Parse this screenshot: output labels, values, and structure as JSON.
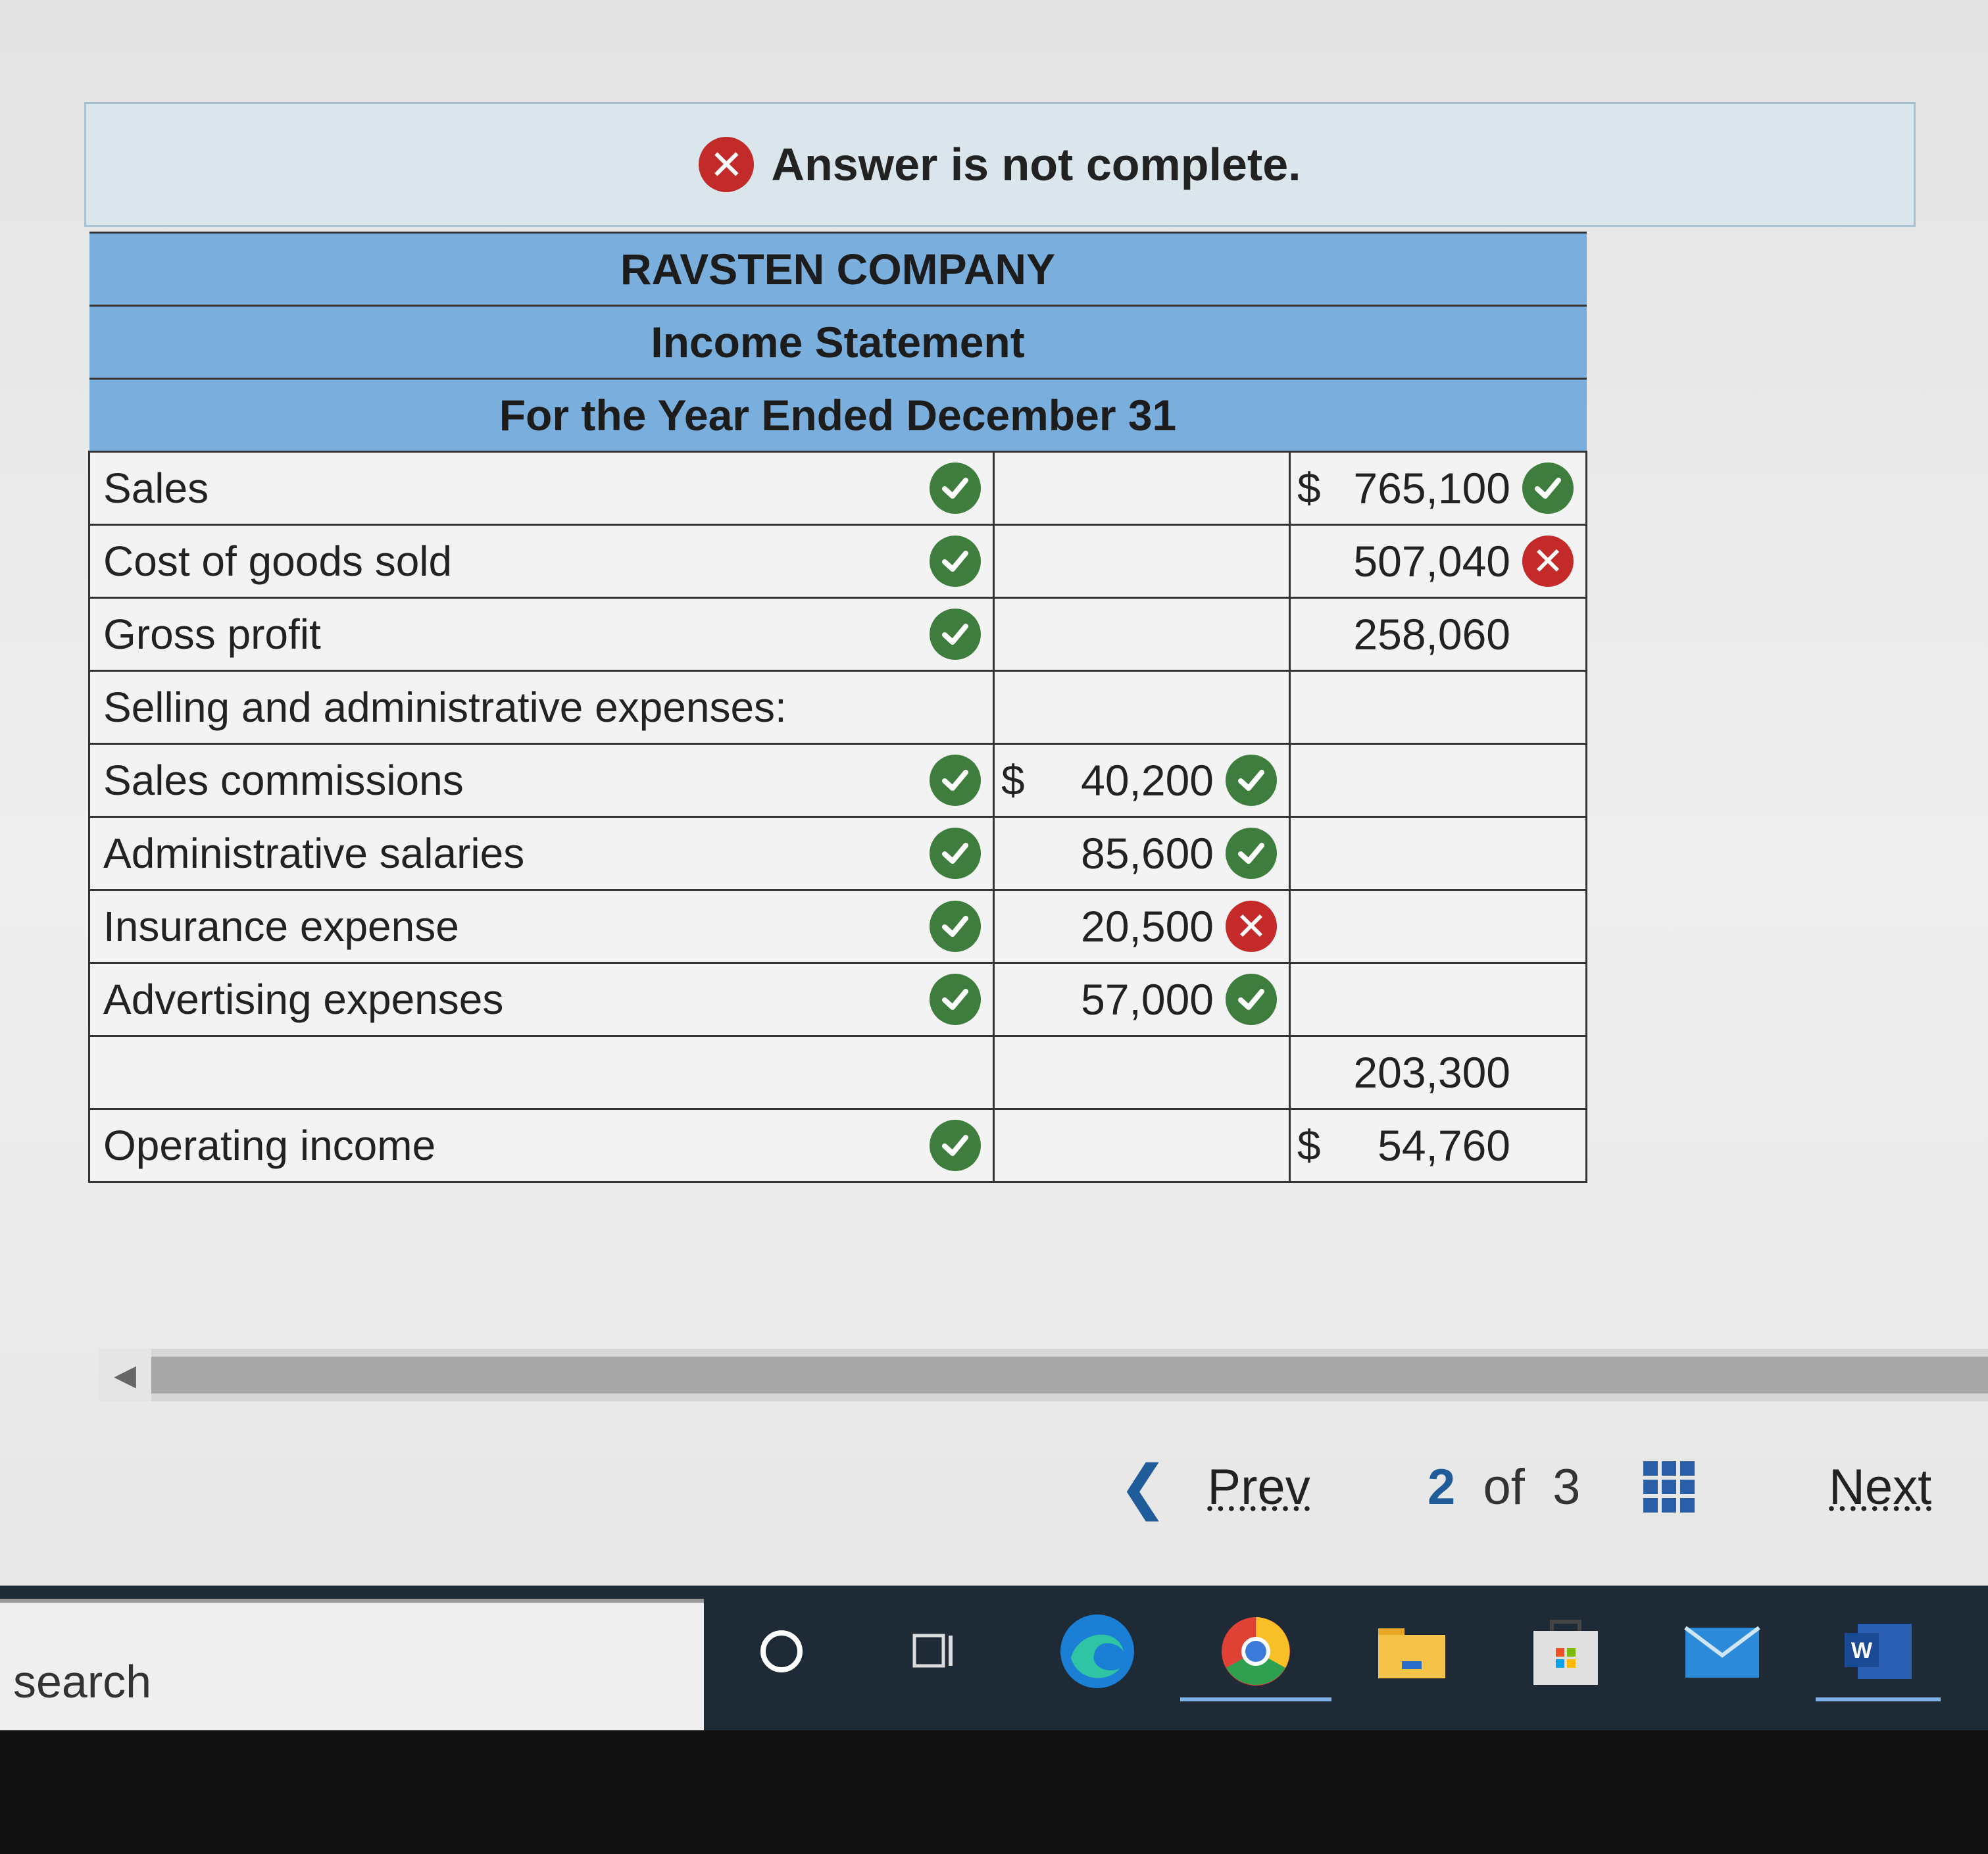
{
  "banner": {
    "text": "Answer is not complete."
  },
  "statement": {
    "company": "RAVSTEN COMPANY",
    "title": "Income Statement",
    "period": "For the Year Ended December 31",
    "rows": [
      {
        "label": "Sales",
        "label_status": "correct",
        "mid_dollar": "",
        "mid_value": "",
        "mid_status": "",
        "right_dollar": "$",
        "right_value": "765,100",
        "right_status": "correct"
      },
      {
        "label": "Cost of goods sold",
        "label_status": "correct",
        "mid_dollar": "",
        "mid_value": "",
        "mid_status": "",
        "right_dollar": "",
        "right_value": "507,040",
        "right_status": "incorrect"
      },
      {
        "label": "Gross profit",
        "label_status": "correct",
        "mid_dollar": "",
        "mid_value": "",
        "mid_status": "",
        "right_dollar": "",
        "right_value": "258,060",
        "right_status": ""
      },
      {
        "label": "Selling and administrative expenses:",
        "label_status": "",
        "mid_dollar": "",
        "mid_value": "",
        "mid_status": "",
        "right_dollar": "",
        "right_value": "",
        "right_status": ""
      },
      {
        "label": "Sales commissions",
        "label_status": "correct",
        "mid_dollar": "$",
        "mid_value": "40,200",
        "mid_status": "correct",
        "right_dollar": "",
        "right_value": "",
        "right_status": ""
      },
      {
        "label": "Administrative salaries",
        "label_status": "correct",
        "mid_dollar": "",
        "mid_value": "85,600",
        "mid_status": "correct",
        "right_dollar": "",
        "right_value": "",
        "right_status": ""
      },
      {
        "label": "Insurance expense",
        "label_status": "correct",
        "mid_dollar": "",
        "mid_value": "20,500",
        "mid_status": "incorrect",
        "right_dollar": "",
        "right_value": "",
        "right_status": ""
      },
      {
        "label": "Advertising expenses",
        "label_status": "correct",
        "mid_dollar": "",
        "mid_value": "57,000",
        "mid_status": "correct",
        "right_dollar": "",
        "right_value": "",
        "right_status": ""
      },
      {
        "label": "",
        "label_status": "",
        "mid_dollar": "",
        "mid_value": "",
        "mid_status": "",
        "right_dollar": "",
        "right_value": "203,300",
        "right_status": ""
      },
      {
        "label": "Operating income",
        "label_status": "correct",
        "mid_dollar": "",
        "mid_value": "",
        "mid_status": "",
        "right_dollar": "$",
        "right_value": "54,760",
        "right_status": ""
      }
    ]
  },
  "pager": {
    "prev": "Prev",
    "current": "2",
    "of": "of",
    "total": "3",
    "next": "Next"
  },
  "taskbar": {
    "search_placeholder": "search",
    "icons": [
      "cortana-icon",
      "task-view-icon",
      "edge-icon",
      "chrome-icon",
      "file-explorer-icon",
      "store-icon",
      "mail-icon",
      "word-icon"
    ]
  },
  "colors": {
    "correct": "#3e7d3d",
    "incorrect": "#c42a2a",
    "header": "#7aaedd",
    "accent": "#1f5c99"
  }
}
